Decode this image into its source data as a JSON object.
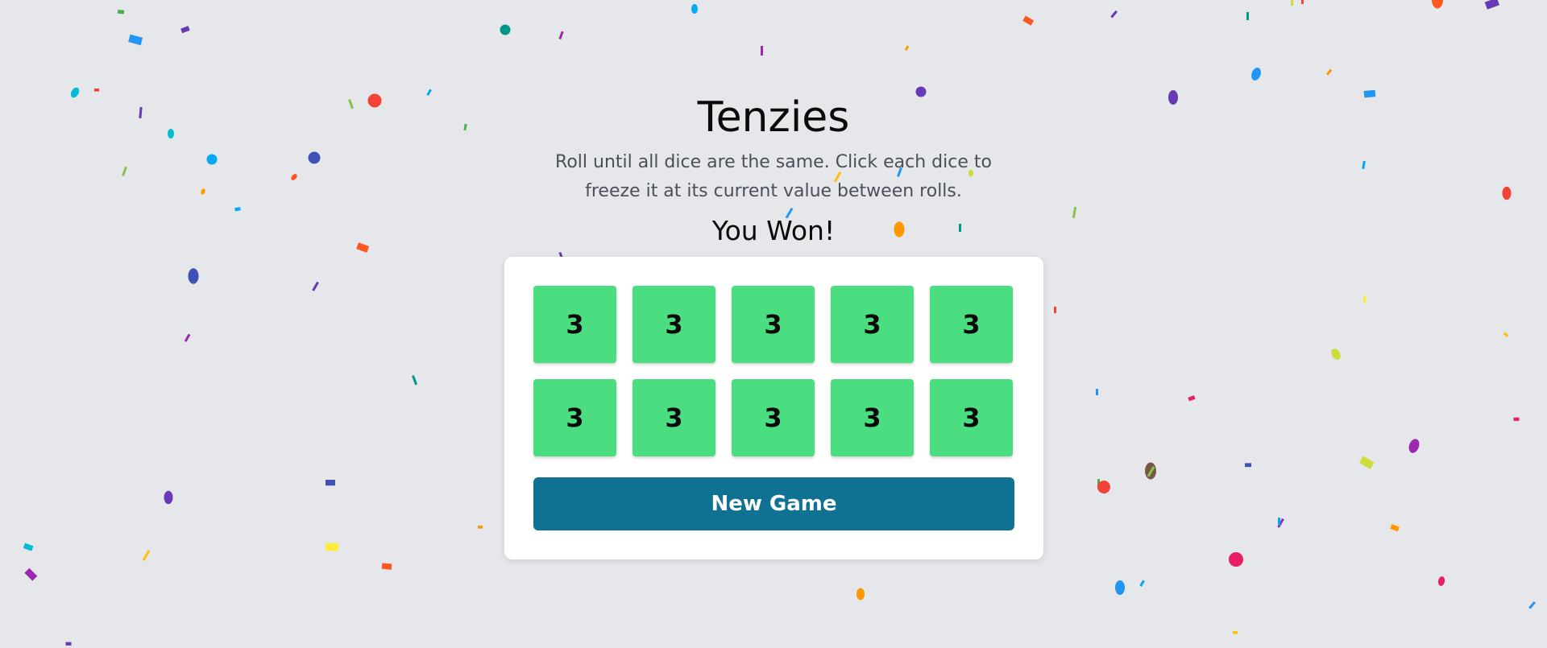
{
  "app": {
    "title": "Tenzies",
    "instructions": "Roll until all dice are the same. Click each dice to freeze it at its current value between rolls.",
    "status": "You Won!"
  },
  "dice": [
    "3",
    "3",
    "3",
    "3",
    "3",
    "3",
    "3",
    "3",
    "3",
    "3"
  ],
  "controls": {
    "new_game_label": "New Game"
  },
  "colors": {
    "background": "#e5e7eb",
    "die_held": "#4ade80",
    "button": "#0f7292",
    "panel": "#ffffff"
  },
  "decorations": {
    "confetti_colors": [
      "#f44336",
      "#e91e63",
      "#9c27b0",
      "#673ab7",
      "#3f51b5",
      "#2196f3",
      "#03a9f4",
      "#00bcd4",
      "#009688",
      "#4caf50",
      "#8bc34a",
      "#cddc39",
      "#ffeb3b",
      "#ffc107",
      "#ff9800",
      "#ff5722",
      "#795548"
    ]
  }
}
